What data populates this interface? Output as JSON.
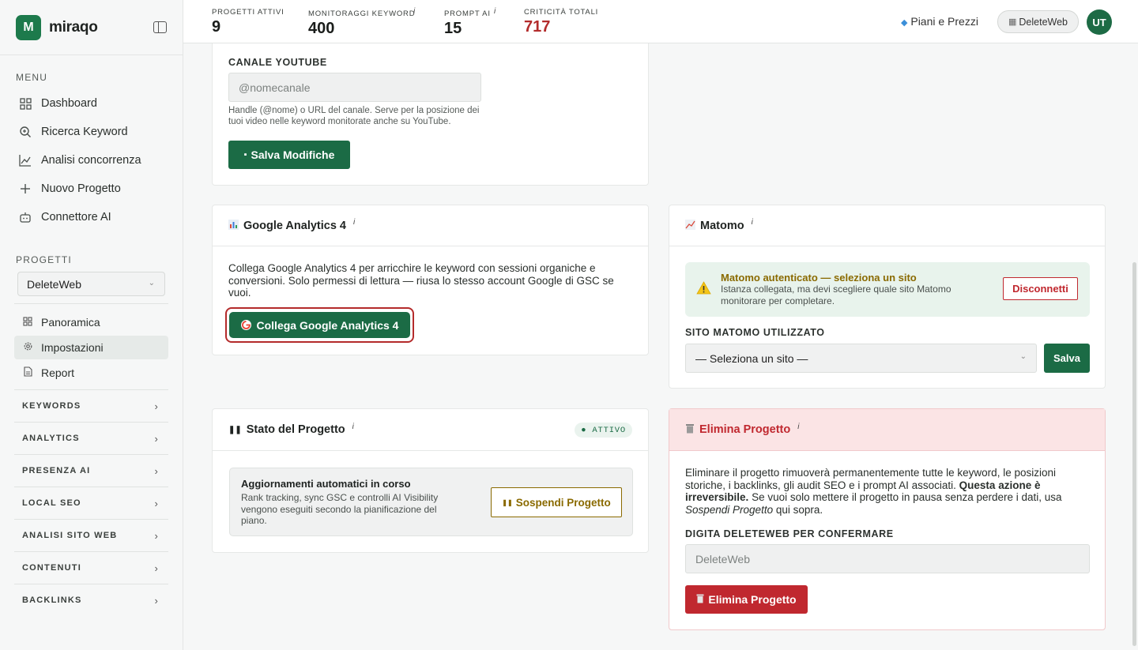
{
  "brand": {
    "name": "miraqo",
    "logo_letter": "M"
  },
  "sidebar": {
    "menu_label": "MENU",
    "menu": [
      {
        "label": "Dashboard",
        "icon": "grid-icon"
      },
      {
        "label": "Ricerca Keyword",
        "icon": "search-icon"
      },
      {
        "label": "Analisi concorrenza",
        "icon": "chart-line-icon"
      },
      {
        "label": "Nuovo Progetto",
        "icon": "plus-icon"
      },
      {
        "label": "Connettore AI",
        "icon": "robot-icon"
      }
    ],
    "projects_label": "PROGETTI",
    "project_selected": "DeleteWeb",
    "project_items": [
      {
        "label": "Panoramica",
        "icon": "grid-icon"
      },
      {
        "label": "Impostazioni",
        "icon": "gear-icon",
        "active": true
      },
      {
        "label": "Report",
        "icon": "document-icon"
      }
    ],
    "groups": [
      "KEYWORDS",
      "ANALYTICS",
      "PRESENZA AI",
      "LOCAL SEO",
      "ANALISI SITO WEB",
      "CONTENUTI",
      "BACKLINKS"
    ]
  },
  "topbar": {
    "stats": [
      {
        "label": "PROGETTI ATTIVI",
        "value": "9"
      },
      {
        "label": "MONITORAGGI KEYWORD",
        "value": "400",
        "info": "i"
      },
      {
        "label": "PROMPT AI",
        "value": "15",
        "info": "i"
      },
      {
        "label": "CRITICITÀ TOTALI",
        "value": "717"
      }
    ],
    "pricing_label": "Piani e Prezzi",
    "site_label": "DeleteWeb",
    "avatar_initials": "UT"
  },
  "youtube": {
    "label": "CANALE YOUTUBE",
    "placeholder": "@nomecanale",
    "help": "Handle (@nome) o URL del canale. Serve per la posizione dei tuoi video nelle keyword monitorate anche su YouTube.",
    "save_label": "Salva Modifiche"
  },
  "ga4": {
    "title": "Google Analytics 4",
    "info": "i",
    "description": "Collega Google Analytics 4 per arricchire le keyword con sessioni organiche e conversioni. Solo permessi di lettura — riusa lo stesso account Google di GSC se vuoi.",
    "connect_label": "Collega Google Analytics 4"
  },
  "matomo": {
    "title": "Matomo",
    "info": "i",
    "alert_title": "Matomo autenticato — seleziona un sito",
    "alert_text": "Istanza collegata, ma devi scegliere quale sito Matomo monitorare per completare.",
    "disconnect_label": "Disconnetti",
    "site_label": "SITO MATOMO UTILIZZATO",
    "site_selected": "— Seleziona un sito —",
    "save_label": "Salva"
  },
  "status": {
    "title": "Stato del Progetto",
    "info": "i",
    "badge": "● ATTIVO",
    "box_title": "Aggiornamenti automatici in corso",
    "box_text": "Rank tracking, sync GSC e controlli AI Visibility vengono eseguiti secondo la pianificazione del piano.",
    "suspend_label": "Sospendi Progetto"
  },
  "delete": {
    "title": "Elimina Progetto",
    "info": "i",
    "text_1": "Eliminare il progetto rimuoverà permanentemente tutte le keyword, le posizioni storiche, i backlinks, gli audit SEO e i prompt AI associati.",
    "text_bold": "Questa azione è irreversibile.",
    "text_2": "Se vuoi solo mettere il progetto in pausa senza perdere i dati, usa",
    "text_italic": "Sospendi Progetto",
    "text_3": "qui sopra.",
    "confirm_label": "DIGITA DELETEWEB PER CONFERMARE",
    "confirm_placeholder": "DeleteWeb",
    "delete_label": "Elimina Progetto"
  },
  "colors": {
    "brand": "#1b6b45",
    "danger": "#c0282f",
    "danger_bg": "#fbe4e5",
    "success_bg": "#e8f3ec",
    "criticita": "#b32c2c"
  }
}
